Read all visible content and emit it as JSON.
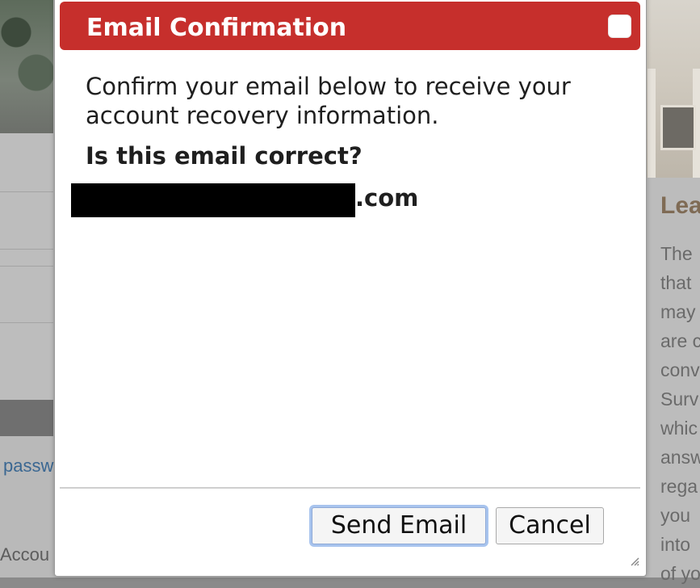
{
  "dialog": {
    "title": "Email Confirmation",
    "message": "Confirm your email below to receive your account recovery information.",
    "question": "Is this email correct?",
    "email_suffix": ".com",
    "buttons": {
      "send": "Send Email",
      "cancel": "Cancel"
    },
    "colors": {
      "title_bar": "#c62f2c",
      "focus_ring": "#a8c4ee"
    },
    "icons": {
      "close": "close-icon",
      "resize": "resize-grip-icon"
    }
  },
  "background": {
    "left_link_partial": "passw",
    "left_bottom_partial": "Accou",
    "right_heading_partial": "Lea",
    "right_text_partial": [
      "The",
      "that",
      "may",
      "are c",
      "conv",
      "Surv",
      "whic",
      "answ",
      "rega",
      "you",
      "into",
      "of yo"
    ]
  }
}
